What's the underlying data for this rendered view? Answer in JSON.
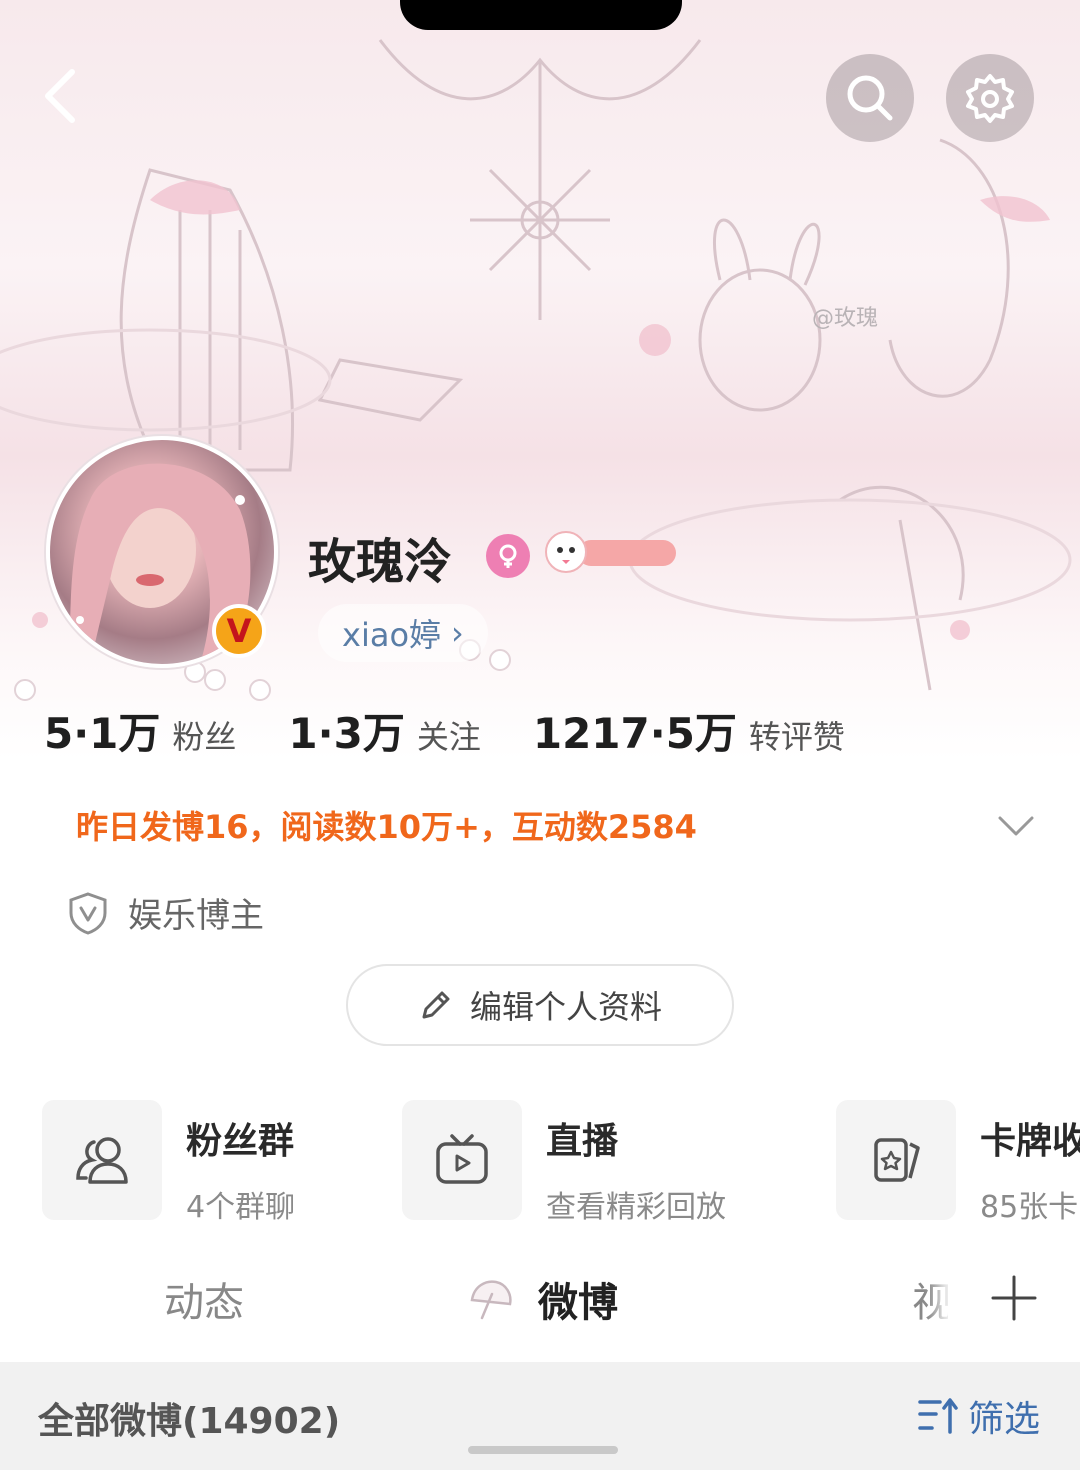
{
  "profile": {
    "name": "玫瑰泠",
    "handle": "xiao婷",
    "handle_arrow": "›",
    "verified_badge": "V",
    "banner_watermark": "@玫瑰"
  },
  "stats": [
    {
      "value": "5·1万",
      "label": "粉丝"
    },
    {
      "value": "1·3万",
      "label": "关注"
    },
    {
      "value": "1217·5万",
      "label": "转评赞"
    }
  ],
  "summary": "昨日发博16，阅读数10万+，互动数2584",
  "tag_label": "娱乐博主",
  "edit_button_label": "编辑个人资料",
  "cards": [
    {
      "title": "粉丝群",
      "subtitle": "4个群聊",
      "icon": "fans-group-icon"
    },
    {
      "title": "直播",
      "subtitle": "查看精彩回放",
      "icon": "live-tv-icon"
    },
    {
      "title": "卡牌收",
      "subtitle": "85张卡",
      "icon": "card-collection-icon"
    }
  ],
  "tabs": [
    {
      "label": "动态"
    },
    {
      "label": "微博"
    },
    {
      "label": "视"
    }
  ],
  "filter_bar": {
    "all_label": "全部微博(14902)",
    "filter_label": "筛选"
  },
  "colors": {
    "summary_orange": "#f0671b",
    "link_blue": "#3f6fae",
    "handle_blue": "#5a7da6",
    "gender_pink": "#ee7fb3",
    "verified_gold": "#f5a418"
  }
}
